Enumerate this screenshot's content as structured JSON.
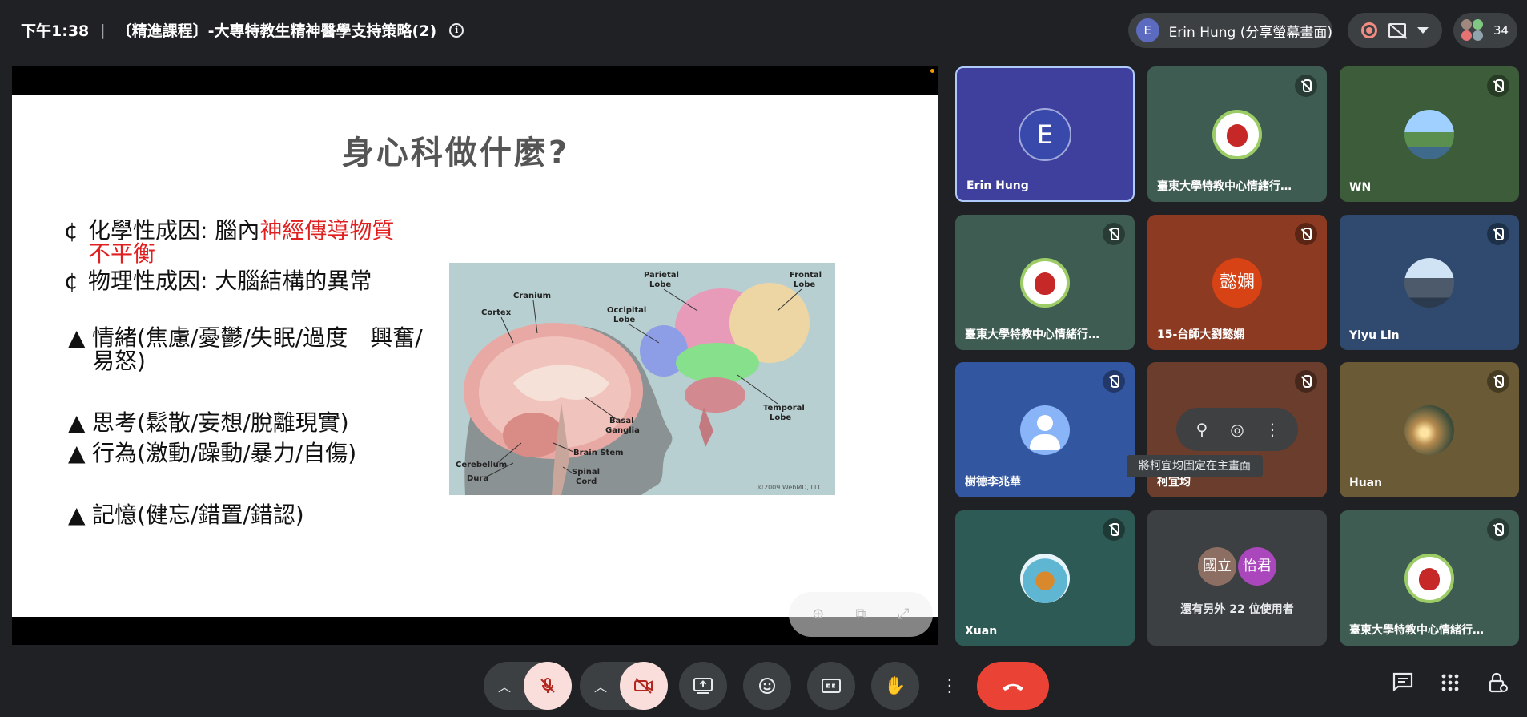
{
  "header": {
    "time": "下午1:38",
    "meeting_title": "〔精進課程〕-大專特教生精神醫學支持策略(2)",
    "info_icon": "i",
    "presenter_initial": "E",
    "presenter_label": "Erin Hung (分享螢幕畫面)",
    "participant_count": "34"
  },
  "slide": {
    "title": "身心科做什麼?",
    "bullets": [
      {
        "mark": "¢",
        "text": "化學性成因: 腦內",
        "highlight": "神經傳導物質不平衡"
      },
      {
        "mark": "¢",
        "text": "物理性成因: 大腦結構的異常"
      },
      {
        "mark": "▲",
        "text": "情緒(焦慮/憂鬱/失眠/過度　興奮/易怒)"
      },
      {
        "mark": "▲",
        "text": "思考(鬆散/妄想/脫離現實)"
      },
      {
        "mark": "▲",
        "text": "行為(激動/躁動/暴力/自傷)"
      },
      {
        "mark": "▲",
        "text": "記憶(健忘/錯置/錯認)"
      }
    ],
    "brain_labels": {
      "cranium": "Cranium",
      "cortex": "Cortex",
      "parietal_1": "Parietal",
      "parietal_2": "Lobe",
      "frontal_1": "Frontal",
      "frontal_2": "Lobe",
      "occipital_1": "Occipital",
      "occipital_2": "Lobe",
      "basal_1": "Basal",
      "basal_2": "Ganglia",
      "temporal_1": "Temporal",
      "temporal_2": "Lobe",
      "brain_stem": "Brain Stem",
      "cerebellum": "Cerebellum",
      "dura": "Dura",
      "spinal_1": "Spinal",
      "spinal_2": "Cord",
      "copyright": "©2009 WebMD, LLC."
    }
  },
  "tiles": [
    {
      "name": "Erin Hung",
      "avatar": "E",
      "muted": false,
      "bg": "#3f3f9e"
    },
    {
      "name": "臺東大學特教中心情緒行…",
      "muted": true,
      "bg": "#3e5c52"
    },
    {
      "name": "WN",
      "muted": true,
      "bg": "#3d5c3a"
    },
    {
      "name": "臺東大學特教中心情緒行…",
      "muted": true,
      "bg": "#3e5c52"
    },
    {
      "name": "15-台師大劉懿嫻",
      "avatar": "懿嫻",
      "muted": true,
      "bg": "#8c3a22"
    },
    {
      "name": "Yiyu Lin",
      "muted": true,
      "bg": "#2f4a6e"
    },
    {
      "name": "樹德李兆華",
      "muted": true,
      "bg": "#3356a0"
    },
    {
      "name": "柯宜均",
      "muted": true,
      "bg": "#6b3d2c"
    },
    {
      "name": "Huan",
      "muted": true,
      "bg": "#6a5a35"
    },
    {
      "name": "Xuan",
      "muted": true,
      "bg": "#2e5a55"
    },
    {
      "name": "臺東大學特教中心情緒行…",
      "muted": true,
      "bg": "#3e5c52"
    }
  ],
  "others_tile": {
    "avatar_1": "國立",
    "avatar_2": "怡君",
    "label": "還有另外 22 位使用者"
  },
  "hover": {
    "tooltip": "將柯宜均固定在主畫面"
  },
  "colors": {
    "background": "#202124",
    "end_call": "#ea4335",
    "muted_control": "#f9dedc",
    "slide_highlight": "#e02020"
  }
}
